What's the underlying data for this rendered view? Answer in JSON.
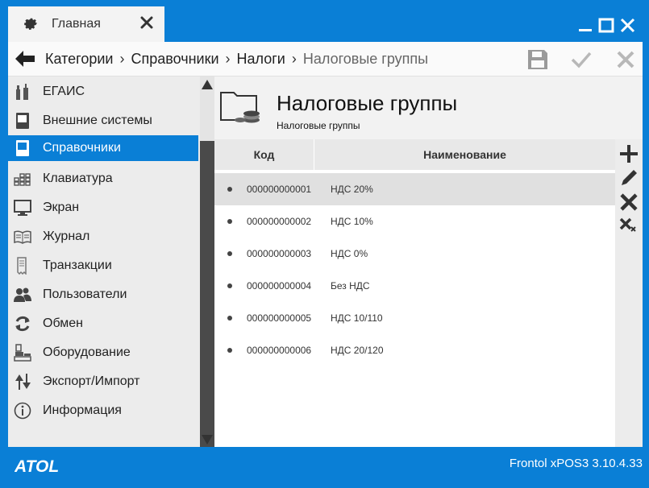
{
  "tab": {
    "label": "Главная"
  },
  "breadcrumb": {
    "items": [
      "Категории",
      "Справочники",
      "Налоги"
    ],
    "current": "Налоговые группы",
    "separator": "›"
  },
  "sidebar": {
    "items": [
      {
        "label": "ЕГАИС",
        "icon": "bottles-icon"
      },
      {
        "label": "Внешние системы",
        "icon": "book-icon"
      },
      {
        "label": "Справочники",
        "icon": "reference-book-icon",
        "active": true
      },
      {
        "label": "Клавиатура",
        "icon": "keyboard-icon"
      },
      {
        "label": "Экран",
        "icon": "monitor-icon"
      },
      {
        "label": "Журнал",
        "icon": "journal-icon"
      },
      {
        "label": "Транзакции",
        "icon": "transactions-icon"
      },
      {
        "label": "Пользователи",
        "icon": "users-icon"
      },
      {
        "label": "Обмен",
        "icon": "exchange-icon"
      },
      {
        "label": "Оборудование",
        "icon": "equipment-icon"
      },
      {
        "label": "Экспорт/Импорт",
        "icon": "export-import-icon"
      },
      {
        "label": "Информация",
        "icon": "info-icon"
      }
    ]
  },
  "page": {
    "title": "Налоговые группы",
    "subtitle": "Налоговые группы"
  },
  "table": {
    "columns": [
      "Код",
      "Наименование"
    ],
    "rows": [
      {
        "code": "000000000001",
        "name": "НДС 20%"
      },
      {
        "code": "000000000002",
        "name": "НДС 10%"
      },
      {
        "code": "000000000003",
        "name": "НДС 0%"
      },
      {
        "code": "000000000004",
        "name": "Без НДС"
      },
      {
        "code": "000000000005",
        "name": "НДС 10/110"
      },
      {
        "code": "000000000006",
        "name": "НДС 20/120"
      }
    ]
  },
  "footer": {
    "brand": "ATOL",
    "version": "Frontol xPOS3 3.10.4.33"
  },
  "colors": {
    "accent": "#0a7fd6",
    "sidebar_bg": "#ececec",
    "header_bg": "#f2f2f2"
  }
}
